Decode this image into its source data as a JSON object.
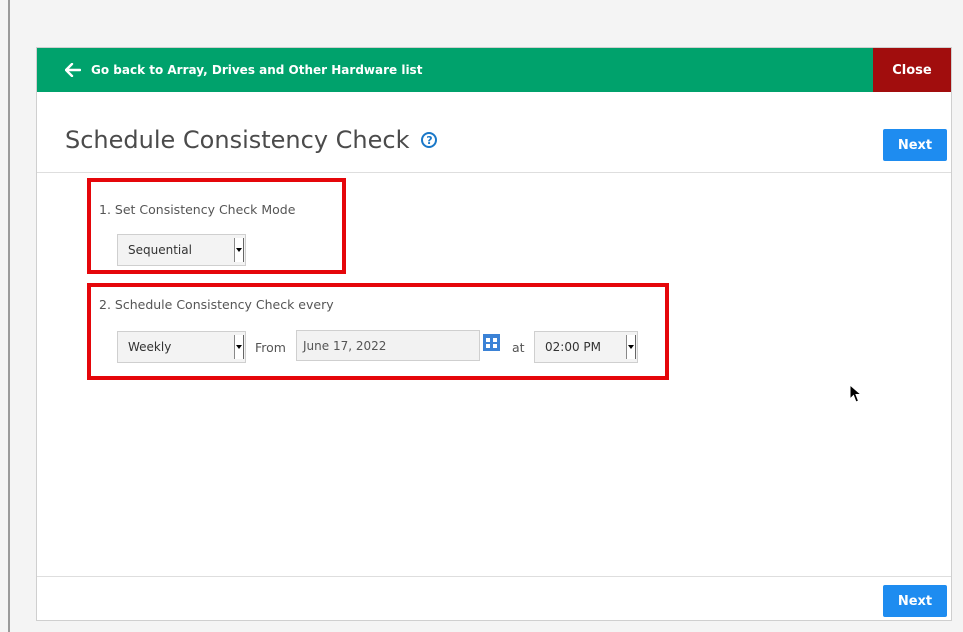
{
  "header": {
    "back_label": "Go back to Array, Drives and Other Hardware list",
    "close_label": "Close"
  },
  "page": {
    "title": "Schedule Consistency Check",
    "help_glyph": "?",
    "next_label_top": "Next",
    "next_label_bottom": "Next"
  },
  "step1": {
    "label": "1. Set Consistency Check Mode",
    "mode_value": "Sequential"
  },
  "step2": {
    "label": "2. Schedule Consistency Check every",
    "frequency_value": "Weekly",
    "from_label": "From",
    "date_value": "June 17, 2022",
    "at_label": "at",
    "time_value": "02:00 PM"
  },
  "colors": {
    "header_green": "#00a26c",
    "close_red": "#a10d0d",
    "next_blue": "#1e8cf0",
    "highlight_red": "#e5060a",
    "help_blue": "#1a78c8"
  },
  "icons": {
    "back": "arrow-left-icon",
    "help": "question-circle-icon",
    "calendar": "calendar-icon",
    "dropdown": "caret-down-icon",
    "pointer": "mouse-pointer-icon"
  }
}
